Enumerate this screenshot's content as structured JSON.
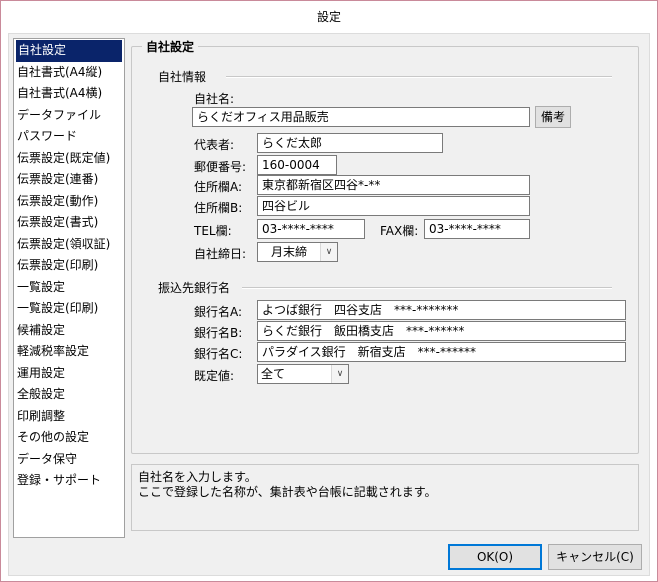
{
  "window": {
    "title": "設定"
  },
  "sidebar": {
    "items": [
      {
        "label": "自社設定",
        "active": true
      },
      {
        "label": "自社書式(A4縦)"
      },
      {
        "label": "自社書式(A4横)"
      },
      {
        "label": "データファイル"
      },
      {
        "label": "パスワード"
      },
      {
        "label": "伝票設定(既定値)"
      },
      {
        "label": "伝票設定(連番)"
      },
      {
        "label": "伝票設定(動作)"
      },
      {
        "label": "伝票設定(書式)"
      },
      {
        "label": "伝票設定(領収証)"
      },
      {
        "label": "伝票設定(印刷)"
      },
      {
        "label": "一覧設定"
      },
      {
        "label": "一覧設定(印刷)"
      },
      {
        "label": "候補設定"
      },
      {
        "label": "軽減税率設定"
      },
      {
        "label": "運用設定"
      },
      {
        "label": "全般設定"
      },
      {
        "label": "印刷調整"
      },
      {
        "label": "その他の設定"
      },
      {
        "label": "データ保守"
      },
      {
        "label": "登録・サポート"
      }
    ]
  },
  "main": {
    "group_title": "自社設定",
    "company": {
      "section_title": "自社情報",
      "name_label": "自社名:",
      "name_value": "らくだオフィス用品販売",
      "memo_button": "備考",
      "rep_label": "代表者:",
      "rep_value": "らくだ太郎",
      "zip_label": "郵便番号:",
      "zip_value": "160-0004",
      "addr_a_label": "住所欄A:",
      "addr_a_value": "東京都新宿区四谷*-**",
      "addr_b_label": "住所欄B:",
      "addr_b_value": "四谷ビル",
      "tel_label": "TEL欄:",
      "tel_value": "03-****-****",
      "fax_label": "FAX欄:",
      "fax_value": "03-****-****",
      "closing_label": "自社締日:",
      "closing_value": "月末締"
    },
    "bank": {
      "section_title": "振込先銀行名",
      "a_label": "銀行名A:",
      "a_value": "よつば銀行　四谷支店　***-*******",
      "b_label": "銀行名B:",
      "b_value": "らくだ銀行　飯田橋支店　***-******",
      "c_label": "銀行名C:",
      "c_value": "パラダイス銀行　新宿支店　***-******",
      "default_label": "既定値:",
      "default_value": "全て"
    }
  },
  "help": {
    "line1": "自社名を入力します。",
    "line2": "ここで登録した名称が、集計表や台帳に記載されます。"
  },
  "buttons": {
    "ok": "OK(O)",
    "cancel": "キャンセル(C)"
  }
}
